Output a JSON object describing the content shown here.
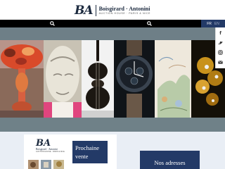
{
  "header": {
    "logo_mark": "BA",
    "logo_name": "Boisgirard · Antonini",
    "logo_tagline": "AUCTION HOUSE · PARIS & NICE"
  },
  "navbar": {
    "left_icon": "search-icon",
    "right_icon": "search-icon",
    "languages": [
      "FR",
      "EN"
    ],
    "active_language": "FR"
  },
  "social": [
    "facebook-icon",
    "twitter-icon",
    "instagram-icon",
    "mail-icon"
  ],
  "hero": {
    "panels": [
      "art-nouveau-lamp",
      "sculpture-face",
      "violin",
      "chronograph-watch",
      "watercolor-painting",
      "gold-brooch"
    ]
  },
  "card": {
    "logo_mark": "BA",
    "logo_name": "Boisgirard · Antonini",
    "logo_tagline": "AUCTION HOUSE · PARIS & NICE",
    "cta_line1": "Prochaine",
    "cta_line2": "vente"
  },
  "address": {
    "label": "Nos adresses"
  },
  "colors": {
    "brand_navy": "#233a67",
    "navbar": "#000000",
    "hero_bg": "#6e7f87",
    "lower_bg": "#e9eef5"
  }
}
